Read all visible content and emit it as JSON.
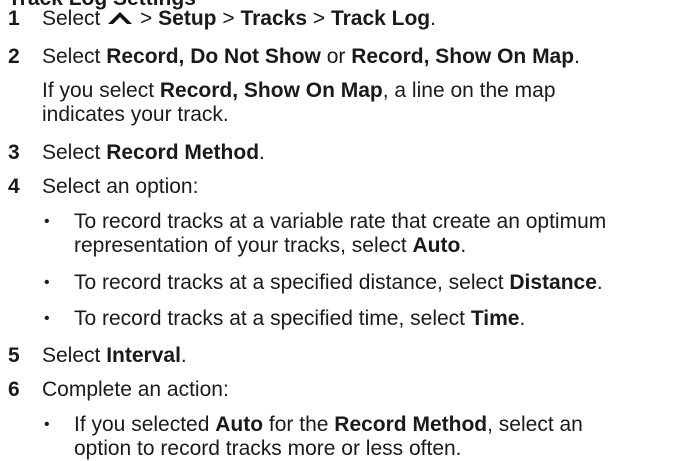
{
  "heading_fragment": "Track Log Settings",
  "steps": [
    {
      "num": "1",
      "pre": "Select",
      "sep1": " > ",
      "a": "Setup",
      "sep2": " > ",
      "b": "Tracks",
      "sep3": " > ",
      "c": "Track Log",
      "end": "."
    },
    {
      "num": "2",
      "pre": "Select ",
      "a": "Record, Do Not Show",
      "mid": " or ",
      "b": "Record, Show On Map",
      "end": "."
    },
    {
      "num": "3",
      "pre": "Select ",
      "a": "Record Method",
      "end": "."
    },
    {
      "num": "4",
      "text": "Select an option:"
    },
    {
      "num": "5",
      "pre": "Select ",
      "a": "Interval",
      "end": "."
    },
    {
      "num": "6",
      "text": "Complete an action:"
    }
  ],
  "note": {
    "line1_pre": "If you select ",
    "line1_bold": "Record, Show On Map",
    "line1_post": ", a line on the map",
    "line2": "indicates your track."
  },
  "options": [
    {
      "line1": "To record tracks at a variable rate that create an optimum",
      "line2_pre": "representation of your tracks, select ",
      "line2_bold": "Auto",
      "line2_end": "."
    },
    {
      "line1_pre": "To record tracks at a specified distance, select ",
      "line1_bold": "Distance",
      "line1_end": "."
    },
    {
      "line1_pre": "To record tracks at a specified time, select ",
      "line1_bold": "Time",
      "line1_end": "."
    }
  ],
  "actions": [
    {
      "l1_pre": "If you selected ",
      "l1_b1": "Auto",
      "l1_mid": " for the ",
      "l1_b2": "Record Method",
      "l1_post": ", select an",
      "line2": "option to record tracks more or less often."
    }
  ],
  "bullet_char": "•",
  "icon": "up-chevron-icon"
}
